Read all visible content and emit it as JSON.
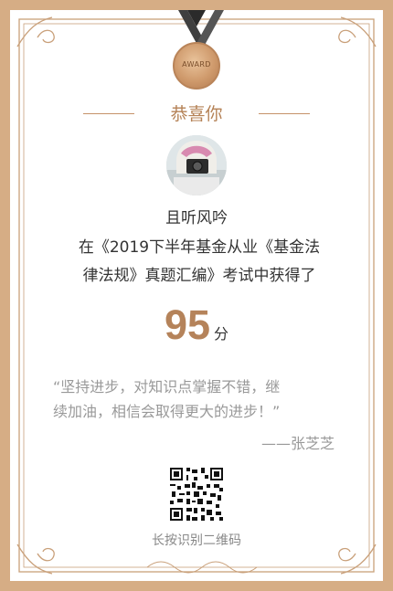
{
  "award": {
    "badge_text": "AWARD"
  },
  "header": {
    "title": "恭喜你"
  },
  "user": {
    "name": "且听风吟"
  },
  "certificate": {
    "line1": "在《2019下半年基金从业《基金法",
    "line2": "律法规》真题汇编》考试中获得了"
  },
  "score": {
    "value": "95",
    "unit": "分"
  },
  "quote": {
    "line1": "“坚持进步，对知识点掌握不错，继",
    "line2": "续加油，相信会取得更大的进步！”",
    "author": "——张芝芝"
  },
  "qr": {
    "caption": "长按识别二维码"
  },
  "colors": {
    "border": "#d6ad85",
    "accent": "#b5835a",
    "text": "#333333",
    "muted": "#999999"
  }
}
